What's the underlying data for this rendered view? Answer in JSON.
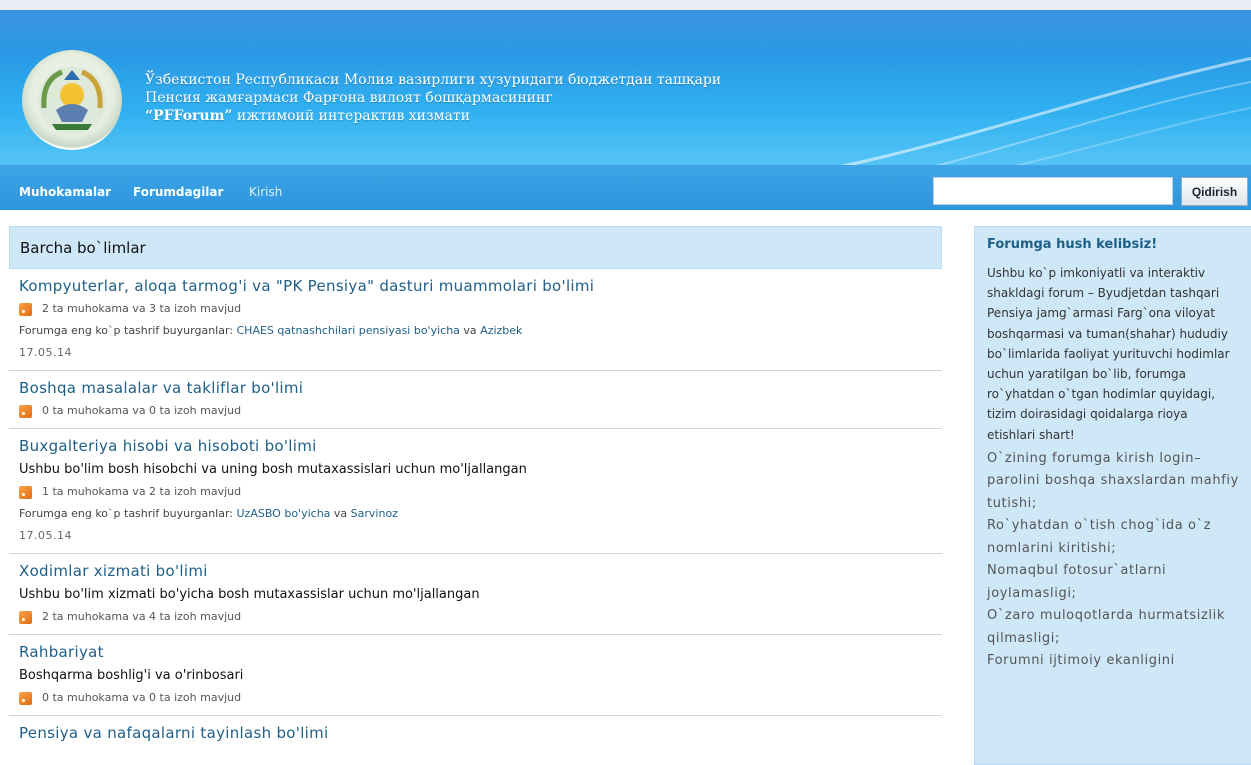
{
  "banner": {
    "line1": "Ўзбекистон Республикаси Молия вазирлиги хузуридаги бюджетдан ташқари",
    "line2": "Пенсия жамғармаси Фарғона вилоят бошқармасининг",
    "line3_bold": "“PFForum”",
    "line3_rest": " ижтимоий интерактив хизмати"
  },
  "nav": {
    "muhokamalar": "Muhokamalar",
    "forumdagilar": "Forumdagilar",
    "kirish": "Kirish"
  },
  "search": {
    "value": "",
    "button": "Qidirish"
  },
  "main": {
    "heading": "Barcha bo`limlar",
    "categories": [
      {
        "title": "Kompyuterlar, aloqa tarmog'i va \"PK Pensiya\" dasturi muammolari bo'limi",
        "stats": "2 ta muhokama va 3 ta izoh mavjud",
        "freq_prefix": "Forumga eng ko`p tashrif buyurganlar: ",
        "freq_link1": "CHAES qatnashchilari pensiyasi bo'yicha",
        "freq_and": " va ",
        "freq_link2": "Azizbek",
        "date": "17.05.14"
      },
      {
        "title": "Boshqa masalalar va takliflar bo'limi",
        "stats": "0 ta muhokama va 0 ta izoh mavjud"
      },
      {
        "title": "Buxgalteriya hisobi va hisoboti bo'limi",
        "desc": "Ushbu bo'lim bosh hisobchi va uning bosh mutaxassislari uchun mo'ljallangan",
        "stats": "1 ta muhokama va 2 ta izoh mavjud",
        "freq_prefix": "Forumga eng ko`p tashrif buyurganlar: ",
        "freq_link1": "UzASBO bo'yicha",
        "freq_and": " va ",
        "freq_link2": "Sarvinoz",
        "date": "17.05.14"
      },
      {
        "title": "Xodimlar xizmati bo'limi",
        "desc": "Ushbu bo'lim xizmati bo'yicha bosh mutaxassislar uchun mo'ljallangan",
        "stats": "2 ta muhokama va 4 ta izoh mavjud"
      },
      {
        "title": "Rahbariyat",
        "desc": "Boshqarma boshlig'i va o'rinbosari",
        "stats": "0 ta muhokama va 0 ta izoh mavjud"
      },
      {
        "title": "Pensiya va nafaqalarni tayinlash bo'limi"
      }
    ]
  },
  "sidebar": {
    "title": "Forumga hush kelibsiz!",
    "body": "Ushbu ko`p imkoniyatli va interaktiv shakldagi forum – Byudjetdan tashqari Pensiya jamg`armasi Farg`ona viloyat boshqarmasi va tuman(shahar) hududiy bo`limlarida faoliyat yurituvchi hodimlar uchun yaratilgan bo`lib, forumga ro`yhatdan o`tgan hodimlar quyidagi, tizim doirasidagi qoidalarga rioya etishlari shart!",
    "rules": [
      "O`zining forumga kirish login–parolini boshqa shaxslardan mahfiy tutishi;",
      "Ro`yhatdan o`tish chog`ida o`z nomlarini kiritishi;",
      "Nomaqbul fotosur`atlarni joylamasligi;",
      "O`zaro muloqotlarda hurmatsizlik qilmasligi;",
      "Forumni ijtimoiy ekanligini"
    ]
  },
  "colors": {
    "banner_blue": "#2e9ae6",
    "nav_blue": "#3a9fe2",
    "panel_blue": "#cfe8f8",
    "link_blue": "#1f5f86",
    "rss_orange": "#f08a2a"
  },
  "icons": {
    "emblem": "state-emblem-icon",
    "rss": "rss-feed-icon"
  }
}
